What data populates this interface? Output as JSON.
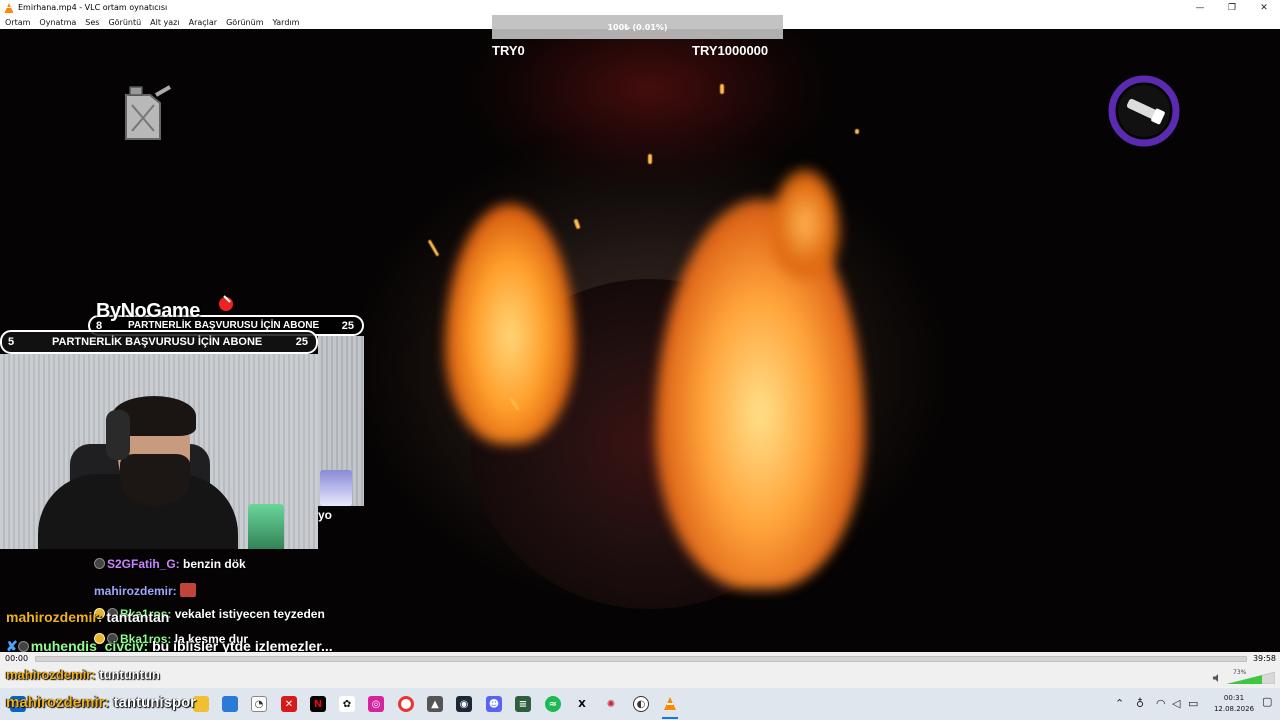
{
  "window": {
    "title": "Emirhana.mp4 - VLC ortam oynatıcısı",
    "controls": [
      "—",
      "❐",
      "✕"
    ]
  },
  "menu": [
    "Ortam",
    "Oynatma",
    "Ses",
    "Görüntü",
    "Alt yazı",
    "Araçlar",
    "Görünüm",
    "Yardım"
  ],
  "overlay": {
    "donation_percent": "100₺ (0.01%)",
    "donation_min": "TRY0",
    "donation_max": "TRY1000000",
    "brand": "ByNoGame",
    "goal_back": {
      "left": "8",
      "text": "PARTNERLİK BAŞVURUSU İÇİN ABONE",
      "right": "25"
    },
    "goal_front": {
      "left": "5",
      "text": "PARTNERLİK BAŞVURUSU İÇİN ABONE",
      "right": "25"
    },
    "cam_side_text": "yo"
  },
  "chat": [
    {
      "user": "S2GFatih_G:",
      "message": "benzin dök",
      "color": "#c983ff"
    },
    {
      "user": "mahirozdemir:",
      "message": "",
      "color": "#9da8ff",
      "emote": true
    },
    {
      "user": "mahirozdemir:",
      "message": "tantantan",
      "color": "#f0b21e"
    },
    {
      "user": "Bka1ros:",
      "message": "vekalet istiyecen teyzeden",
      "color": "#8cff8c"
    },
    {
      "user": "Bka1ros:",
      "message": "la kesme dur",
      "color": "#8cff8c"
    },
    {
      "user": "muhendis_civciv:",
      "message": "bu iblisler ytde izlemezler...",
      "color": "#8cff8c"
    },
    {
      "user": "mahirozdemir:",
      "message": "tuntuntun",
      "color": "#f0b21e"
    },
    {
      "user": "mahirozdemir:",
      "message": "tantunispor",
      "color": "#f0b21e"
    }
  ],
  "player": {
    "time_elapsed": "00:00",
    "time_total": "39:58",
    "volume": "73%",
    "volume_level": 0.73
  },
  "taskbar": {
    "clock_time": "00:31",
    "clock_date": "12.08.2026"
  },
  "colors": {
    "flame": "#ffa43a",
    "vlc_orange": "#ff8800",
    "volume_green": "#3cc83c"
  }
}
